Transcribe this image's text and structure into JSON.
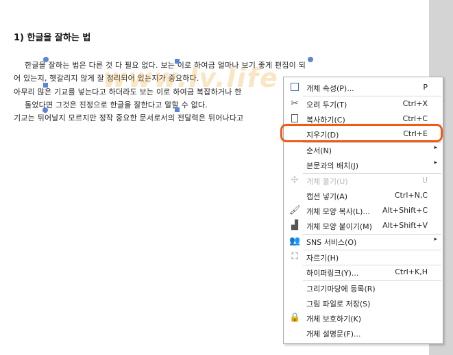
{
  "document": {
    "heading": "1) 한글을 잘하는 법",
    "lines": [
      "한글을 잘하는 법은 다른 것 다 필요 없다. 보는 이로 하여금 얼마나 보기 좋게 편집이 되",
      "어 있는지, 헷갈리지 않게 잘 정리되어 있는지가 중요하다.",
      "아무리 많은 기교를 넣는다고 하더라도 보는 이로 하여금 복잡하거나 한",
      "돌었다면 그것은 진정으로 한글을 잘한다고 말할 수 없다.",
      "기교는 뒤어날지 모르지만 정작 중요한 문서로서의 전달력은 뒤어나다고"
    ],
    "watermark": "www.lv.life"
  },
  "context_menu": {
    "items": [
      {
        "label": "개체 속성(P)...",
        "shortcut": "P",
        "icon": "object-properties-icon",
        "disabled": false,
        "submenu": false
      },
      {
        "label": "오려 두기(T)",
        "shortcut": "Ctrl+X",
        "icon": "scissors-icon",
        "disabled": false,
        "submenu": false
      },
      {
        "label": "복사하기(C)",
        "shortcut": "Ctrl+C",
        "icon": "copy-icon",
        "disabled": false,
        "submenu": false
      },
      {
        "label": "지우기(D)",
        "shortcut": "Ctrl+E",
        "icon": "",
        "disabled": false,
        "submenu": false
      },
      {
        "label": "순서(N)",
        "shortcut": "",
        "icon": "",
        "disabled": false,
        "submenu": true
      },
      {
        "label": "본문과의 배치(J)",
        "shortcut": "",
        "icon": "",
        "disabled": false,
        "submenu": true
      },
      {
        "label": "개체 풀기(U)",
        "shortcut": "U",
        "icon": "ungroup-icon",
        "disabled": true,
        "submenu": false
      },
      {
        "label": "캡션 넣기(A)",
        "shortcut": "Ctrl+N,C",
        "icon": "",
        "disabled": false,
        "submenu": false
      },
      {
        "label": "개체 모양 복사(L)...",
        "shortcut": "Alt+Shift+C",
        "icon": "format-copy-icon",
        "disabled": false,
        "submenu": false
      },
      {
        "label": "개체 모양 붙이기(M)",
        "shortcut": "Alt+Shift+V",
        "icon": "format-paste-icon",
        "disabled": false,
        "submenu": false
      },
      {
        "label": "SNS 서비스(O)",
        "shortcut": "",
        "icon": "sns-people-icon",
        "disabled": false,
        "submenu": true
      },
      {
        "label": "자르기(H)",
        "shortcut": "",
        "icon": "crop-icon",
        "disabled": false,
        "submenu": false
      },
      {
        "label": "하이퍼링크(Y)...",
        "shortcut": "Ctrl+K,H",
        "icon": "",
        "disabled": false,
        "submenu": false
      },
      {
        "label": "그리기마당에 등록(R)",
        "shortcut": "",
        "icon": "",
        "disabled": false,
        "submenu": false
      },
      {
        "label": "그림 파일로 저장(S)",
        "shortcut": "",
        "icon": "",
        "disabled": false,
        "submenu": false
      },
      {
        "label": "개체 보호하기(K)",
        "shortcut": "",
        "icon": "lock-icon",
        "disabled": false,
        "submenu": false
      },
      {
        "label": "개체 설명문(F)...",
        "shortcut": "",
        "icon": "",
        "disabled": false,
        "submenu": false
      }
    ],
    "highlight_color": "#f05a14"
  }
}
